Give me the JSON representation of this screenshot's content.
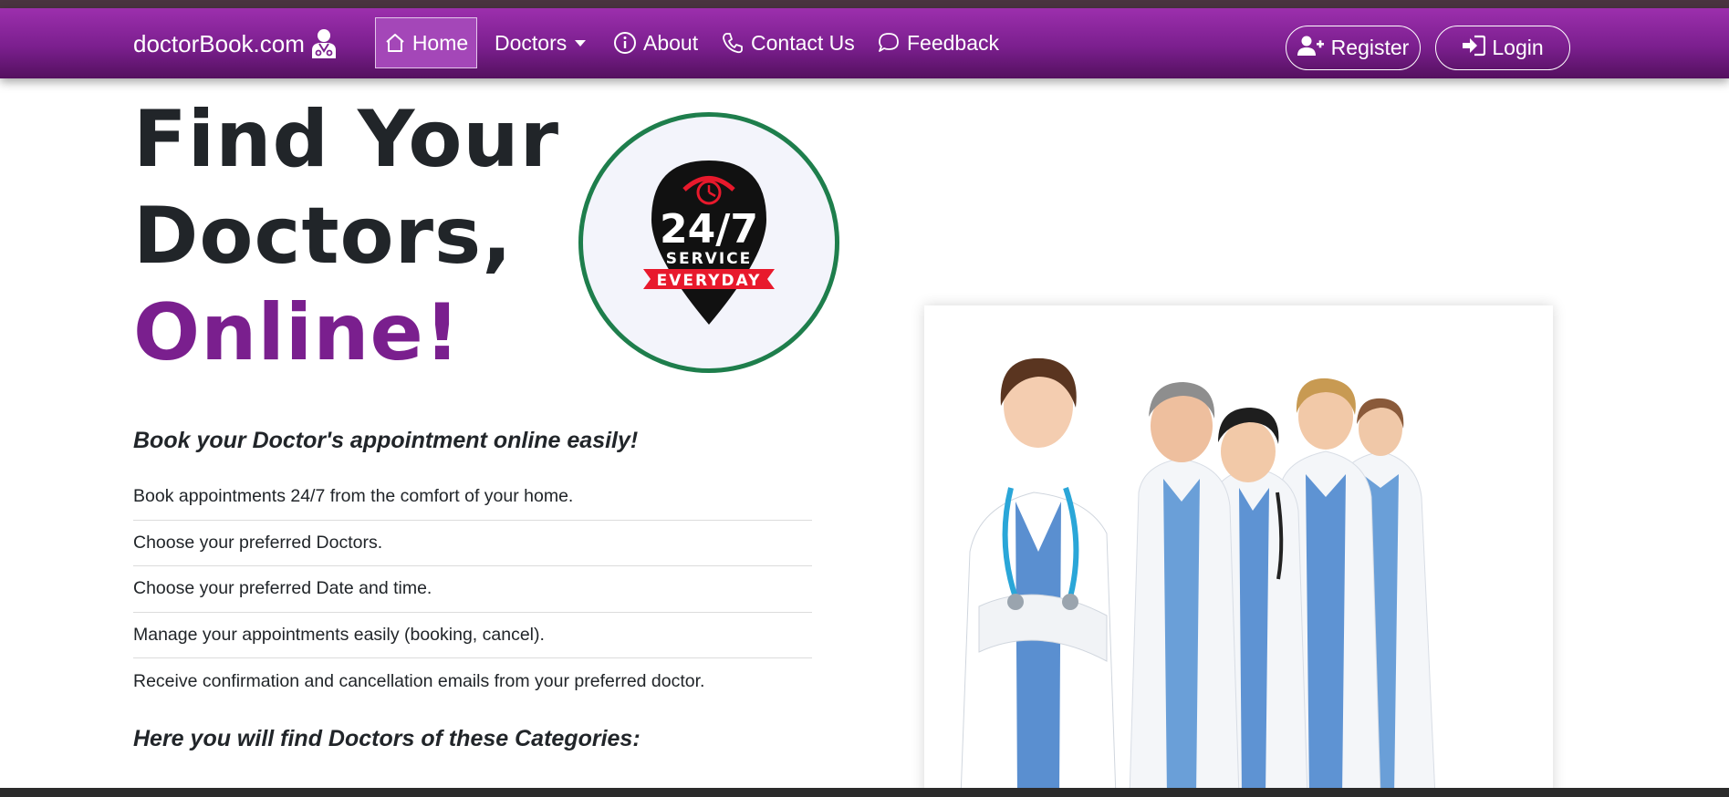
{
  "navbar": {
    "brand": "doctorBook.com",
    "items": [
      {
        "label": "Home",
        "icon": "home-icon",
        "active": true
      },
      {
        "label": "Doctors",
        "icon": "",
        "dropdown": true
      },
      {
        "label": "About",
        "icon": "info-icon"
      },
      {
        "label": "Contact Us",
        "icon": "phone-icon"
      },
      {
        "label": "Feedback",
        "icon": "chat-icon"
      }
    ],
    "register_label": "Register",
    "login_label": "Login"
  },
  "hero": {
    "title_line1": "Find Your",
    "title_line2": "Doctors,",
    "title_line3": "Online!",
    "badge": {
      "big": "24/7",
      "service": "SERVICE",
      "ribbon": "EVERYDAY"
    }
  },
  "content": {
    "subhead": "Book your Doctor's appointment online easily!",
    "features": [
      "Book appointments 24/7 from the comfort of your home.",
      "Choose your preferred Doctors.",
      "Choose your preferred Date and time.",
      "Manage your appointments easily (booking, cancel).",
      "Receive confirmation and cancellation emails from your preferred doctor."
    ],
    "categories_heading": "Here you will find Doctors of these Categories:"
  },
  "colors": {
    "navbar": "#7b1f8e",
    "accent_text": "#7a1f8e",
    "badge_border": "#1e7e4c",
    "badge_ribbon": "#e8192c"
  }
}
